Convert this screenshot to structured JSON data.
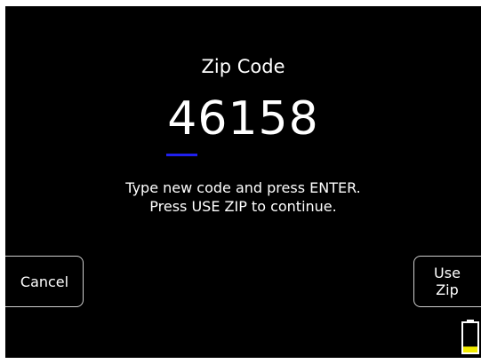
{
  "screen": {
    "title": "Zip Code",
    "zip_value": "46158",
    "instructions": [
      "Type new code and press ENTER.",
      "Press USE ZIP to continue."
    ]
  },
  "softkeys": {
    "cancel_label": "Cancel",
    "use_zip_label_line1": "Use",
    "use_zip_label_line2": "Zip"
  },
  "battery": {
    "charge_level": 0.2,
    "fill_color": "#f3ec00",
    "outline_color": "#ffffff"
  },
  "colors": {
    "background": "#000000",
    "text": "#ffffff",
    "cursor": "#2020ee",
    "button_border": "#cfcfcf"
  }
}
